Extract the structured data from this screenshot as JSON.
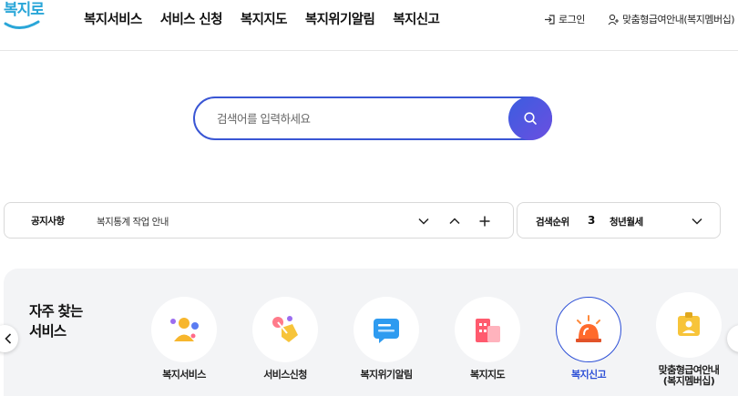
{
  "header": {
    "logo_text": "복지로",
    "nav": [
      "복지서비스",
      "서비스 신청",
      "복지지도",
      "복지위기알림",
      "복지신고"
    ],
    "login_label": "로그인",
    "guide_label": "맞춤형급여안내(복지멤버십)"
  },
  "search": {
    "placeholder": "검색어를 입력하세요"
  },
  "notice": {
    "label": "공지사항",
    "text": "복지통계 작업 안내"
  },
  "ranking": {
    "label": "검색순위",
    "rank": "3",
    "term": "청년월세"
  },
  "services": {
    "title_line1": "자주 찾는",
    "title_line2": "서비스",
    "items": [
      {
        "label": "복지서비스",
        "icon": "people-icon"
      },
      {
        "label": "서비스신청",
        "icon": "hand-pointer-icon"
      },
      {
        "label": "복지위기알림",
        "icon": "message-icon"
      },
      {
        "label": "복지지도",
        "icon": "map-building-icon"
      },
      {
        "label": "복지신고",
        "icon": "siren-icon",
        "active": true
      },
      {
        "label": "맞춤형급여안내\n(복지멤버십)",
        "icon": "id-card-icon"
      }
    ]
  },
  "colors": {
    "accent": "#3a56d4",
    "active_label": "#2c4fd6",
    "panel_bg": "#f3f4f6"
  }
}
